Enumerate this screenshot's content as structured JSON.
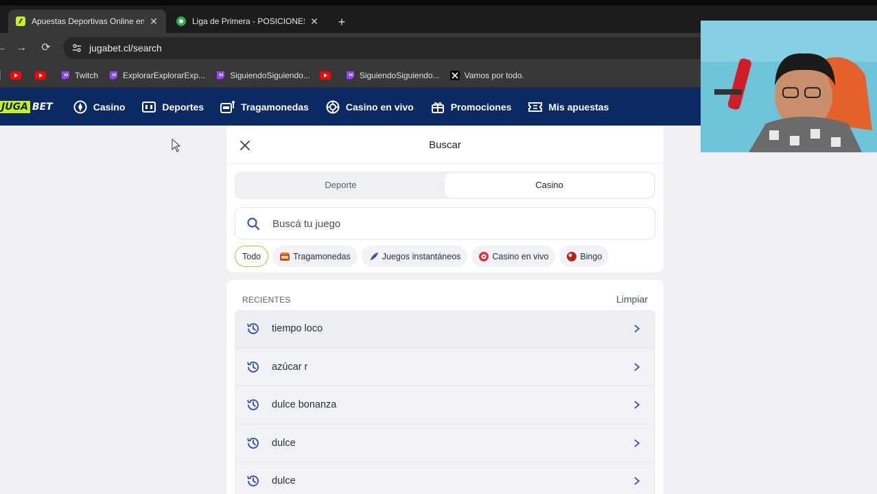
{
  "browser": {
    "tabs": [
      {
        "title": "Apuestas Deportivas Online en",
        "active": true,
        "favicon": "jugabet-icon"
      },
      {
        "title": "Liga de Primera - POSICIONES,",
        "active": false,
        "favicon": "soccer-ball-icon"
      }
    ],
    "new_tab_label": "+",
    "url": "jugabet.cl/search",
    "bookmarks": [
      {
        "label": "",
        "icon": "youtube-icon"
      },
      {
        "label": "",
        "icon": "youtube-icon"
      },
      {
        "label": "Twitch",
        "icon": "twitch-icon"
      },
      {
        "label": "ExplorarExplorarExp...",
        "icon": "twitch-icon"
      },
      {
        "label": "SiguiendoSiguiendo...",
        "icon": "twitch-icon"
      },
      {
        "label": "",
        "icon": "youtube-icon"
      },
      {
        "label": "SiguiendoSiguiendo...",
        "icon": "twitch-icon"
      },
      {
        "label": "Vamos por todo.",
        "icon": "x-icon"
      }
    ]
  },
  "site": {
    "logo_left": "JUGA",
    "logo_right": "BET",
    "nav": [
      {
        "label": "Casino",
        "icon": "casino-chip-icon"
      },
      {
        "label": "Deportes",
        "icon": "scoreboard-icon"
      },
      {
        "label": "Tragamonedas",
        "icon": "slot-machine-icon"
      },
      {
        "label": "Casino en vivo",
        "icon": "roulette-icon"
      },
      {
        "label": "Promociones",
        "icon": "gift-icon"
      },
      {
        "label": "Mis apuestas",
        "icon": "ticket-icon"
      }
    ]
  },
  "search_panel": {
    "title": "Buscar",
    "segments": [
      "Deporte",
      "Casino"
    ],
    "active_segment": "Casino",
    "search_placeholder": "Buscá tu juego",
    "chips": [
      {
        "label": "Todo",
        "selected": true
      },
      {
        "label": "Tragamonedas",
        "icon": "slot-machine-icon"
      },
      {
        "label": "Juegos instantáneos",
        "icon": "rocket-icon"
      },
      {
        "label": "Casino en vivo",
        "icon": "roulette-icon"
      },
      {
        "label": "Bingo",
        "icon": "bingo-ball-icon"
      }
    ],
    "recent_label": "RECIENTES",
    "clear_label": "Limpiar",
    "recent": [
      "tiempo loco",
      "azúcar r",
      "dulce bonanza",
      "dulce",
      "dulce"
    ]
  },
  "colors": {
    "nav_bg": "#0b2a63",
    "brand_lime": "#c8f21a",
    "page_bg": "#eef0f3",
    "accent_icon": "#3b5aa8"
  }
}
